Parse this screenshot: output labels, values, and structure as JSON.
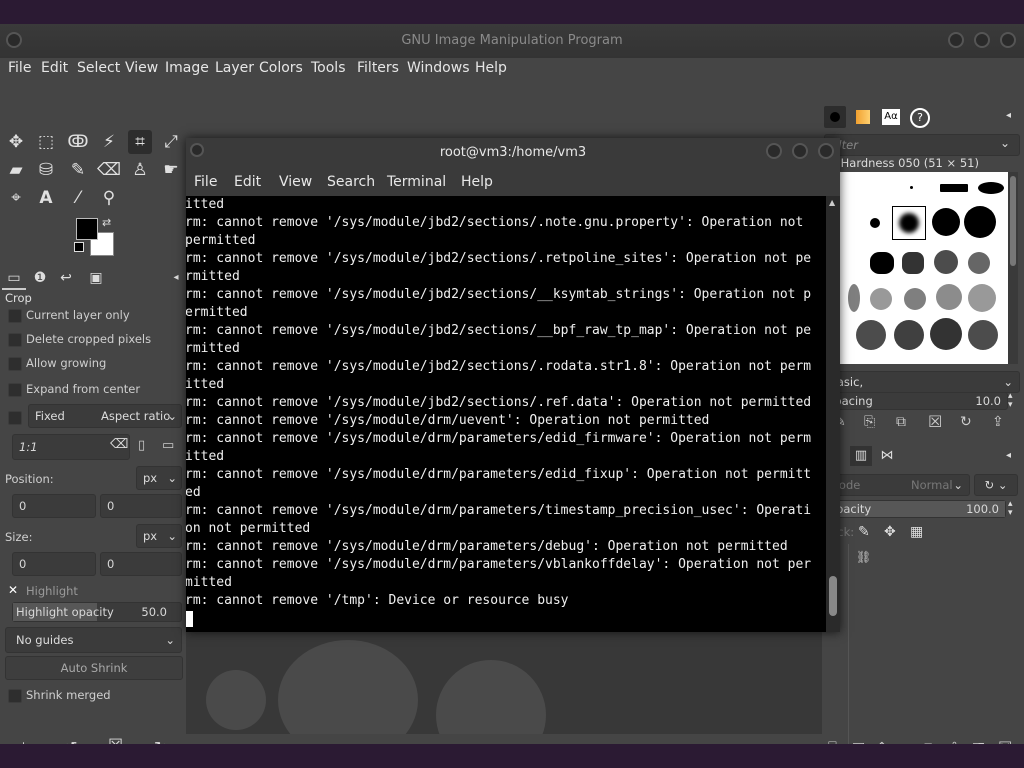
{
  "gimp": {
    "title": "GNU Image Manipulation Program",
    "menu": [
      "File",
      "Edit",
      "Select",
      "View",
      "Image",
      "Layer",
      "Colors",
      "Tools",
      "Filters",
      "Windows",
      "Help"
    ]
  },
  "tool_options": {
    "tool_name": "Crop",
    "current_layer_only": "Current layer only",
    "delete_cropped": "Delete cropped pixels",
    "allow_growing": "Allow growing",
    "expand_from_center": "Expand from center",
    "fixed_label": "Fixed",
    "fixed_mode": "Aspect ratio",
    "ratio_value": "1:1",
    "position_label": "Position:",
    "position_unit": "px",
    "position_x": "0",
    "position_y": "0",
    "size_label": "Size:",
    "size_unit": "px",
    "size_w": "0",
    "size_h": "0",
    "highlight_label": "Highlight",
    "highlight_opacity_label": "Highlight opacity",
    "highlight_opacity_value": "50.0",
    "guides": "No guides",
    "auto_shrink": "Auto Shrink",
    "shrink_merged": "Shrink merged"
  },
  "brushes": {
    "filter_placeholder": "filter",
    "selected_brush": "2. Hardness 050 (51 × 51)",
    "preset": "Basic,",
    "spacing_label": "Spacing",
    "spacing_value": "10.0"
  },
  "layers": {
    "mode_label": "Mode",
    "mode_value": "Normal",
    "opacity_label": "Opacity",
    "opacity_value": "100.0",
    "lock_label": "Lock:"
  },
  "terminal": {
    "title": "root@vm3:/home/vm3",
    "menu": [
      "File",
      "Edit",
      "View",
      "Search",
      "Terminal",
      "Help"
    ],
    "lines": [
      "itted",
      "rm: cannot remove '/sys/module/jbd2/sections/.note.gnu.property': Operation not",
      "permitted",
      "rm: cannot remove '/sys/module/jbd2/sections/.retpoline_sites': Operation not pe",
      "rmitted",
      "rm: cannot remove '/sys/module/jbd2/sections/__ksymtab_strings': Operation not p",
      "ermitted",
      "rm: cannot remove '/sys/module/jbd2/sections/__bpf_raw_tp_map': Operation not pe",
      "rmitted",
      "rm: cannot remove '/sys/module/jbd2/sections/.rodata.str1.8': Operation not perm",
      "itted",
      "rm: cannot remove '/sys/module/jbd2/sections/.ref.data': Operation not permitted",
      "rm: cannot remove '/sys/module/drm/uevent': Operation not permitted",
      "rm: cannot remove '/sys/module/drm/parameters/edid_firmware': Operation not perm",
      "itted",
      "rm: cannot remove '/sys/module/drm/parameters/edid_fixup': Operation not permitt",
      "ed",
      "rm: cannot remove '/sys/module/drm/parameters/timestamp_precision_usec': Operati",
      "on not permitted",
      "rm: cannot remove '/sys/module/drm/parameters/debug': Operation not permitted",
      "rm: cannot remove '/sys/module/drm/parameters/vblankoffdelay': Operation not per",
      "mitted",
      "rm: cannot remove '/tmp': Device or resource busy"
    ]
  }
}
